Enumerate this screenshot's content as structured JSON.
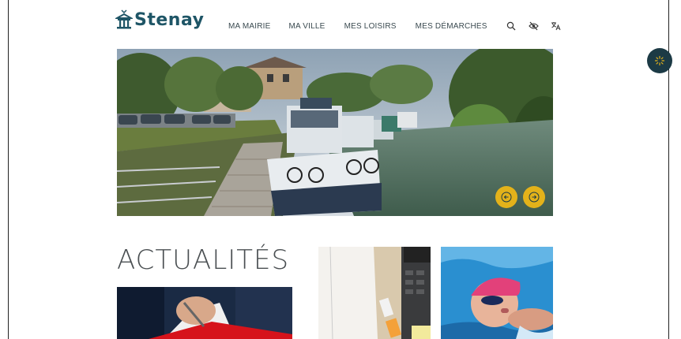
{
  "brand": {
    "name": "Stenay",
    "color": "#1e5566"
  },
  "nav": {
    "items": [
      {
        "label": "MA MAIRIE"
      },
      {
        "label": "MA VILLE"
      },
      {
        "label": "MES LOISIRS"
      },
      {
        "label": "MES DÉMARCHES"
      }
    ]
  },
  "tools": {
    "icons": [
      "search-icon",
      "eye-off-icon",
      "translate-icon"
    ]
  },
  "accessibility": {
    "icon": "sparkle-icon",
    "color": "#1c3a45"
  },
  "hero": {
    "image": "canal-boats-photo",
    "controls": {
      "prev_icon": "arrow-left-icon",
      "next_icon": "arrow-right-icon",
      "color": "#e3b21a"
    }
  },
  "news": {
    "title": "ACTUALITÉS",
    "cards": [
      {
        "image": "ribbon-cutting-photo"
      },
      {
        "image": "notebook-laptop-photo"
      },
      {
        "image": "swimmer-photo"
      }
    ]
  }
}
